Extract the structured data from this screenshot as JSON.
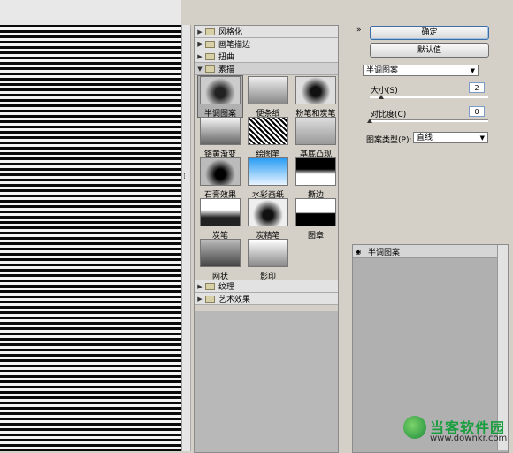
{
  "gallery": {
    "categories_top": [
      {
        "label": "风格化",
        "open": false
      },
      {
        "label": "画笔描边",
        "open": false
      },
      {
        "label": "扭曲",
        "open": false
      },
      {
        "label": "素描",
        "open": true
      }
    ],
    "filters": [
      {
        "label": "半调图案",
        "selected": true
      },
      {
        "label": "便条纸"
      },
      {
        "label": "粉笔和炭笔"
      },
      {
        "label": "铬黄渐变"
      },
      {
        "label": "绘图笔"
      },
      {
        "label": "基底凸现"
      },
      {
        "label": "石膏效果"
      },
      {
        "label": "水彩画纸"
      },
      {
        "label": "撕边"
      },
      {
        "label": "炭笔"
      },
      {
        "label": "炭精笔"
      },
      {
        "label": "图章"
      },
      {
        "label": "网状"
      },
      {
        "label": "影印"
      }
    ],
    "categories_bottom": [
      {
        "label": "纹理"
      },
      {
        "label": "艺术效果"
      }
    ]
  },
  "right": {
    "ok_label": "确定",
    "default_label": "默认值",
    "collapse_glyph": "»",
    "filter_select": "半调图案",
    "size_label": "大小(S)",
    "size_value": "2",
    "contrast_label": "对比度(C)",
    "contrast_value": "0",
    "pattern_type_label": "图案类型(P):",
    "pattern_type_value": "直线",
    "size_slider_fraction": 0.1,
    "contrast_slider_fraction": 0.0,
    "layer_name": "半调图案",
    "eye_icon": "eye-icon"
  },
  "watermark": {
    "title": "当客软件园",
    "url": "www.downkr.com"
  }
}
